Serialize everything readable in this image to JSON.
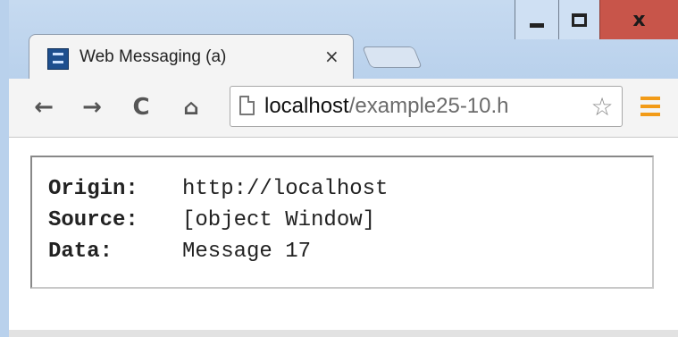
{
  "browser": {
    "tab": {
      "title": "Web Messaging (a)",
      "close_glyph": "×",
      "favicon": "page-favicon"
    },
    "window_controls": {
      "minimize_icon": "minimize-icon",
      "maximize_icon": "maximize-icon",
      "close_glyph": "x"
    },
    "toolbar": {
      "back_glyph": "←",
      "forward_glyph": "→",
      "reload_glyph": "C",
      "home_glyph": "⌂",
      "url_host": "localhost",
      "url_path": "/example25-10.h",
      "star_glyph": "☆",
      "menu_icon": "hamburger-menu-icon",
      "menu_color": "#f29b18"
    }
  },
  "message": {
    "origin_label": "Origin:",
    "origin_value": "http://localhost",
    "source_label": "Source:",
    "source_value": "[object Window]",
    "data_label": "Data:",
    "data_value": "Message 17"
  }
}
